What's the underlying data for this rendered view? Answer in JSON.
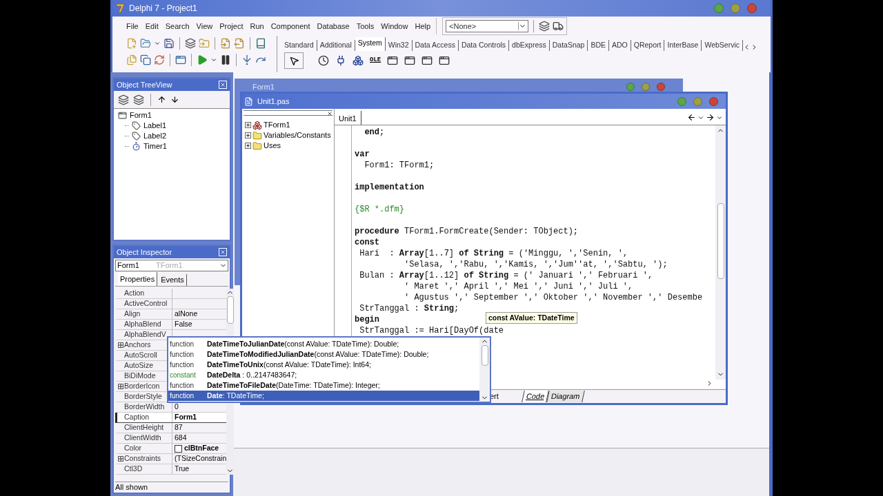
{
  "main_window": {
    "title": "Delphi 7 - Project1",
    "menu": [
      "File",
      "Edit",
      "Search",
      "View",
      "Project",
      "Run",
      "Component",
      "Database",
      "Tools",
      "Window",
      "Help"
    ],
    "combo": {
      "value": "<None>"
    },
    "palette_tabs": [
      {
        "label": "Standard",
        "selected": false
      },
      {
        "label": "Additional",
        "selected": false
      },
      {
        "label": "System",
        "selected": true
      },
      {
        "label": "Win32",
        "selected": false
      },
      {
        "label": "Data Access",
        "selected": false
      },
      {
        "label": "Data Controls",
        "selected": false
      },
      {
        "label": "dbExpress",
        "selected": false
      },
      {
        "label": "DataSnap",
        "selected": false
      },
      {
        "label": "BDE",
        "selected": false
      },
      {
        "label": "ADO",
        "selected": false
      },
      {
        "label": "QReport",
        "selected": false
      },
      {
        "label": "InterBase",
        "selected": false
      },
      {
        "label": "WebServic",
        "selected": false
      }
    ],
    "ole_label": "OLE"
  },
  "tree_view": {
    "title": "Object TreeView",
    "items": [
      {
        "label": "Form1",
        "kind": "form",
        "children": [
          {
            "label": "Label1",
            "kind": "label"
          },
          {
            "label": "Label2",
            "kind": "label"
          },
          {
            "label": "Timer1",
            "kind": "timer"
          }
        ]
      }
    ]
  },
  "inspector": {
    "title": "Object Inspector",
    "object": "Form1",
    "type": "TForm1",
    "tabs": [
      {
        "label": "Properties",
        "selected": true
      },
      {
        "label": "Events",
        "selected": false
      }
    ],
    "rows": [
      {
        "name": "Action",
        "kind": "plain",
        "modified": false,
        "selected": false
      },
      {
        "name": "ActiveControl",
        "kind": "plain",
        "modified": false,
        "selected": false
      },
      {
        "name": "Align",
        "value": "alNone",
        "kind": "plain",
        "modified": false,
        "selected": false
      },
      {
        "name": "AlphaBlend",
        "value": "False",
        "kind": "plain",
        "modified": false,
        "selected": false
      },
      {
        "name": "AlphaBlendV",
        "kind": "plain",
        "modified": false,
        "selected": false
      },
      {
        "name": "Anchors",
        "kind": "group",
        "modified": false,
        "selected": false
      },
      {
        "name": "AutoScroll",
        "kind": "plain",
        "modified": false,
        "selected": false
      },
      {
        "name": "AutoSize",
        "kind": "plain",
        "modified": false,
        "selected": false
      },
      {
        "name": "BiDiMode",
        "kind": "plain",
        "modified": false,
        "selected": false
      },
      {
        "name": "BorderIcon",
        "kind": "group",
        "modified": false,
        "selected": false
      },
      {
        "name": "BorderStyle",
        "kind": "plain",
        "modified": false,
        "selected": false
      },
      {
        "name": "BorderWidth",
        "value": "0",
        "kind": "plain",
        "modified": false,
        "selected": false
      },
      {
        "name": "Caption",
        "value": "Form1",
        "kind": "plain",
        "modified": true,
        "selected": true
      },
      {
        "name": "ClientHeight",
        "value": "87",
        "kind": "plain",
        "modified": false,
        "selected": false
      },
      {
        "name": "ClientWidth",
        "value": "684",
        "kind": "plain",
        "modified": false,
        "selected": false
      },
      {
        "name": "Color",
        "value": "clBtnFace",
        "kind": "color",
        "modified": true,
        "selected": false
      },
      {
        "name": "Constraints",
        "value": "(TSizeConstrain",
        "kind": "group",
        "modified": false,
        "selected": false
      },
      {
        "name": "Ctl3D",
        "value": "True",
        "kind": "plain",
        "modified": false,
        "selected": false
      }
    ],
    "status": "All shown"
  },
  "form_window": {
    "title": "Form1"
  },
  "editor": {
    "title": "Unit1.pas",
    "explorer": [
      {
        "label": "TForm1",
        "kind": "class",
        "expanded": false
      },
      {
        "label": "Variables/Constants",
        "kind": "folder",
        "expanded": false
      },
      {
        "label": "Uses",
        "kind": "folder",
        "expanded": false
      }
    ],
    "tabs": [
      {
        "label": "Unit1",
        "selected": true
      }
    ],
    "lines": [
      {
        "kind": "code",
        "text": "  **end**;"
      },
      {
        "kind": "blank"
      },
      {
        "kind": "code",
        "text": "**var**"
      },
      {
        "kind": "code",
        "text": "  Form1: TForm1;"
      },
      {
        "kind": "blank"
      },
      {
        "kind": "code",
        "text": "**implementation**"
      },
      {
        "kind": "blank"
      },
      {
        "kind": "comment",
        "text": "{$R *.dfm}"
      },
      {
        "kind": "blank"
      },
      {
        "kind": "code",
        "text": "**procedure** TForm1.FormCreate(Sender: TObject);"
      },
      {
        "kind": "code",
        "text": "**const**"
      },
      {
        "kind": "code",
        "text": " Hari  : **Array**[1..7] **of** **String** = ('Minggu, ','Senin, ',"
      },
      {
        "kind": "code",
        "text": "          'Selasa, ','Rabu, ','Kamis, ','Jum''at, ','Sabtu, ');"
      },
      {
        "kind": "code",
        "text": " Bulan : **Array**[1..12] **of** **String** = (' Januari ',' Februari ',"
      },
      {
        "kind": "code",
        "text": "          ' Maret ',' April ',' Mei ',' Juni ',' Juli ',"
      },
      {
        "kind": "code",
        "text": "          ' Agustus ',' September ',' Oktober ',' November ',' Desembe"
      },
      {
        "kind": "code",
        "text": " StrTanggal : **String**;"
      },
      {
        "kind": "code",
        "text": "**begin**"
      },
      {
        "kind": "code",
        "text": " StrTanggal := Hari[DayOf(date"
      }
    ],
    "hint": "const AValue: TDateTime",
    "status": "ert",
    "view_tabs": [
      {
        "label": "Code",
        "selected": true
      },
      {
        "label": "Diagram",
        "selected": false
      }
    ]
  },
  "completion": [
    {
      "label": "function",
      "kind": "function",
      "name": "DateTimeToJulianDate",
      "signature": "(const AValue: TDateTime): Double;",
      "selected": false
    },
    {
      "label": "function",
      "kind": "function",
      "name": "DateTimeToModifiedJulianDate",
      "signature": "(const AValue: TDateTime): Double;",
      "selected": false
    },
    {
      "label": "function",
      "kind": "function",
      "name": "DateTimeToUnix",
      "signature": "(const AValue: TDateTime): Int64;",
      "selected": false
    },
    {
      "label": "constant",
      "kind": "constant",
      "name": "DateDelta",
      "signature": " : 0..2147483647;",
      "selected": false
    },
    {
      "label": "function",
      "kind": "function",
      "name": "DateTimeToFileDate",
      "signature": "(DateTime: TDateTime): Integer;",
      "selected": false
    },
    {
      "label": "function",
      "kind": "function",
      "name": "Date",
      "signature": ": TDateTime;",
      "selected": true
    }
  ]
}
